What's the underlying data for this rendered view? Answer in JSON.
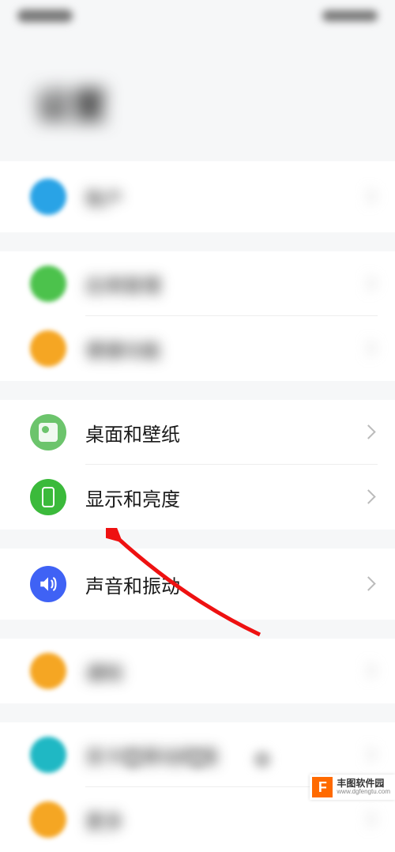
{
  "status": {
    "left": "",
    "right": ""
  },
  "page": {
    "title": "设置"
  },
  "rows": {
    "account": {
      "label": "账户",
      "value": ""
    },
    "app": {
      "label": "应用管理"
    },
    "util": {
      "label": "便捷功能"
    },
    "wallpaper": {
      "label": "桌面和壁纸"
    },
    "display": {
      "label": "显示和亮度"
    },
    "sound": {
      "label": "声音和振动"
    },
    "notif": {
      "label": "通知"
    },
    "net": {
      "label": "双卡和移动网络"
    },
    "more": {
      "label": "更多"
    }
  },
  "watermark": {
    "title": "丰图软件园",
    "url": "www.dgfengtu.com"
  }
}
